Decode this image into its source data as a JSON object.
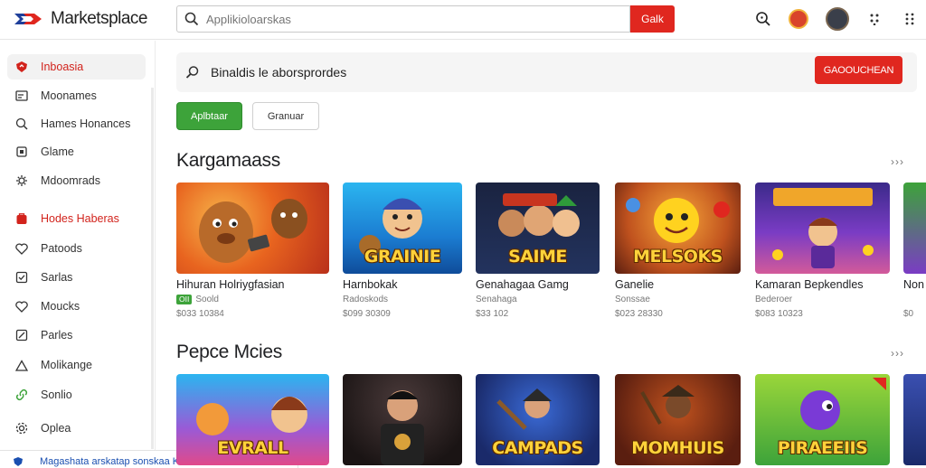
{
  "app": {
    "name": "Marketsplace",
    "logo_icon": "flag-logo-icon",
    "colors": {
      "accent": "#e0271f",
      "green": "#3da33a"
    }
  },
  "search": {
    "placeholder": "Applikioloarskas",
    "value": "",
    "button_label": "Galk"
  },
  "header_icons": [
    "search-icon",
    "mascot-avatar",
    "user-avatar",
    "apps-grid-icon",
    "more-vert-icon"
  ],
  "sidebar": {
    "items": [
      {
        "label": "Inboasia",
        "icon": "shield-icon"
      },
      {
        "label": "Moonames",
        "icon": "mail-icon"
      },
      {
        "label": "Hames Honances",
        "icon": "search-user-icon"
      },
      {
        "label": "Glame",
        "icon": "copy-icon"
      },
      {
        "label": "Mdoomrads",
        "icon": "gear-icon"
      },
      {
        "label": "Hodes Haberas",
        "icon": "red-bag-icon"
      },
      {
        "label": "Patoods",
        "icon": "heart-icon"
      },
      {
        "label": "Sarlas",
        "icon": "checkbox-icon"
      },
      {
        "label": "Moucks",
        "icon": "heart-outline-icon"
      },
      {
        "label": "Parles",
        "icon": "edit-box-icon"
      },
      {
        "label": "Molikange",
        "icon": "triangle-icon"
      },
      {
        "label": "Sonlio",
        "icon": "link-icon"
      },
      {
        "label": "Oplea",
        "icon": "settings-icon"
      }
    ],
    "toast": "Magashata arskatap sonskaa Karsuasosaot"
  },
  "banner": {
    "text": "Binaldis le aborsprordes",
    "button_label": "GAOOUCHEAN"
  },
  "chips": [
    "Aplbtaar",
    "Granuar"
  ],
  "sections": [
    {
      "title": "Kargamaass",
      "more": "›››",
      "cards": [
        {
          "title": "Hihuran Holriygfasian",
          "badge": "OII",
          "meta": "Soold",
          "price": "$033 10384",
          "thumb_text": ""
        },
        {
          "title": "Harnbokak",
          "badge": "",
          "meta": "Radoskods",
          "price": "$099 30309",
          "thumb_text": "GRAINIE"
        },
        {
          "title": "Genahagaa Gamg",
          "badge": "",
          "meta": "Senahaga",
          "price": "$33 102",
          "thumb_text": "SAIME"
        },
        {
          "title": "Ganelie",
          "badge": "",
          "meta": "Sonssae",
          "price": "$023 28330",
          "thumb_text": "MELSOKS"
        },
        {
          "title": "Kamaran Bepkendles",
          "badge": "",
          "meta": "Bederoer",
          "price": "$083 10323",
          "thumb_text": ""
        },
        {
          "title": "Non",
          "badge": "",
          "meta": "",
          "price": "$0",
          "thumb_text": ""
        }
      ]
    },
    {
      "title": "Pepce Mcies",
      "more": "›››",
      "cards": [
        {
          "title": "",
          "badge": "",
          "meta": "",
          "price": "",
          "thumb_text": "EVRALL"
        },
        {
          "title": "",
          "badge": "",
          "meta": "",
          "price": "",
          "thumb_text": ""
        },
        {
          "title": "",
          "badge": "",
          "meta": "",
          "price": "",
          "thumb_text": "CAMPADS"
        },
        {
          "title": "",
          "badge": "",
          "meta": "",
          "price": "",
          "thumb_text": "MOMHUIS"
        },
        {
          "title": "",
          "badge": "",
          "meta": "",
          "price": "",
          "thumb_text": "PIRAEEIIS"
        },
        {
          "title": "",
          "badge": "",
          "meta": "",
          "price": "",
          "thumb_text": ""
        }
      ]
    }
  ]
}
